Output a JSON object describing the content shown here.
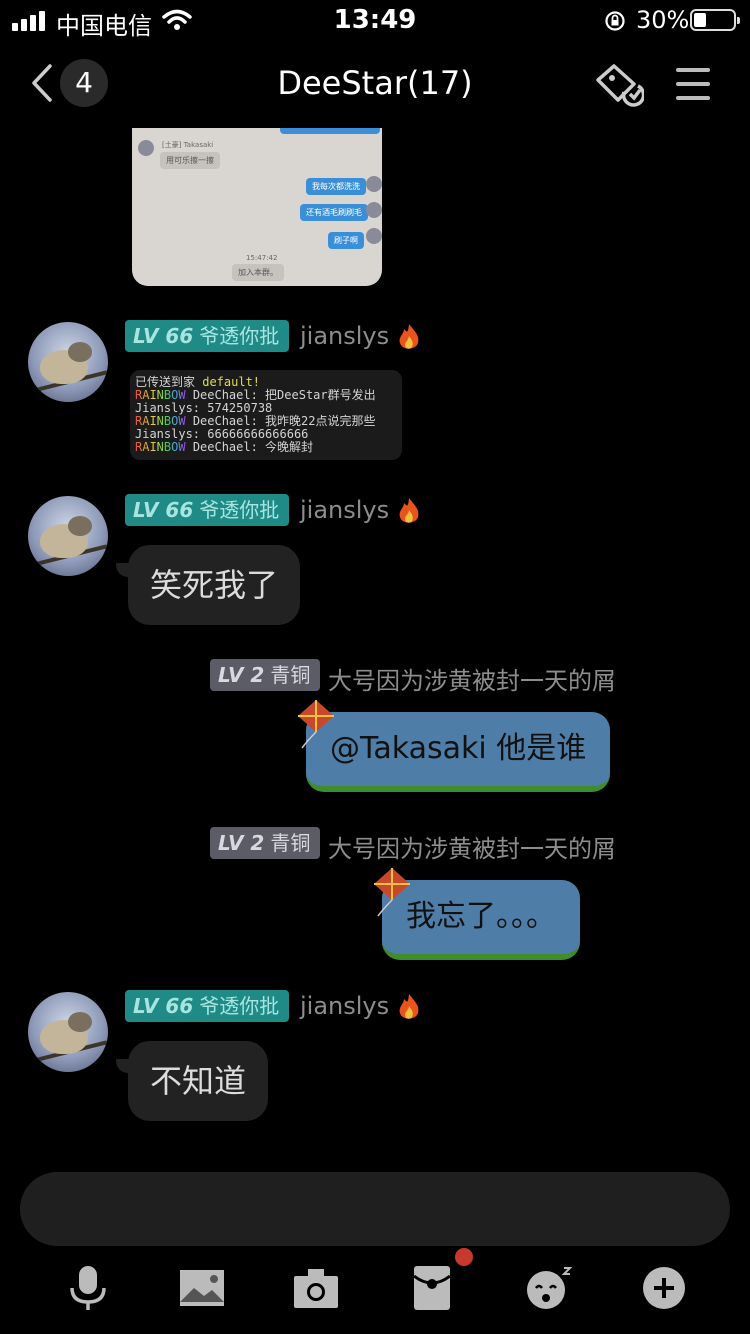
{
  "status_bar": {
    "carrier": "中国电信",
    "time": "13:49",
    "battery_percent": "30%",
    "battery_level": 0.3
  },
  "header": {
    "unread_count": "4",
    "title": "DeeStar(17)",
    "icons": [
      "back-chevron-icon",
      "tag-icon",
      "menu-icon"
    ]
  },
  "shared_screenshot": {
    "sender_label": "[土豪] Takasaki",
    "incoming_text": "用可乐擦一擦",
    "outgoing": [
      "我每次都洗洗",
      "还有酒毛刷刷毛",
      "刷子啊"
    ],
    "time": "15:47:42",
    "system_text": "加入本群。"
  },
  "messages": [
    {
      "side": "left",
      "level": "LV 66",
      "title": "爷透你批",
      "nickname": "jianslys",
      "type": "game_chat",
      "lines": [
        {
          "prefix": "",
          "name": "",
          "text": "已传送到家 ",
          "highlight": "default!"
        },
        {
          "prefix": "RAINBOW",
          "name": "DeeChael",
          "text": ": 把DeeStar群号发出"
        },
        {
          "prefix": "",
          "name": "Jianslys",
          "text": ": 574250738"
        },
        {
          "prefix": "RAINBOW",
          "name": "DeeChael",
          "text": ": 我昨晚22点说完那些"
        },
        {
          "prefix": "",
          "name": "Jianslys",
          "text": ": 66666666666666"
        },
        {
          "prefix": "RAINBOW",
          "name": "DeeChael",
          "text": ": 今晚解封"
        }
      ]
    },
    {
      "side": "left",
      "level": "LV 66",
      "title": "爷透你批",
      "nickname": "jianslys",
      "text": "笑死我了"
    },
    {
      "side": "right",
      "level": "LV 2",
      "title": "青铜",
      "nickname": "大号因为涉黄被封一天的屑",
      "text": "@Takasaki 他是谁"
    },
    {
      "side": "right",
      "level": "LV 2",
      "title": "青铜",
      "nickname": "大号因为涉黄被封一天的屑",
      "text": "我忘了。。。"
    },
    {
      "side": "left",
      "level": "LV 66",
      "title": "爷透你批",
      "nickname": "jianslys",
      "text": "不知道"
    }
  ],
  "toolbar": {
    "icons": [
      "microphone-icon",
      "image-icon",
      "camera-icon",
      "red-packet-icon",
      "sticker-icon",
      "plus-icon"
    ],
    "has_notification": true
  },
  "colors": {
    "background": "#000000",
    "level_teal": "#1f8a86",
    "level_grey": "#5c5c66",
    "bubble_dark": "#222222",
    "bubble_kite": "#4e7ea8",
    "notification": "#c8382c"
  }
}
